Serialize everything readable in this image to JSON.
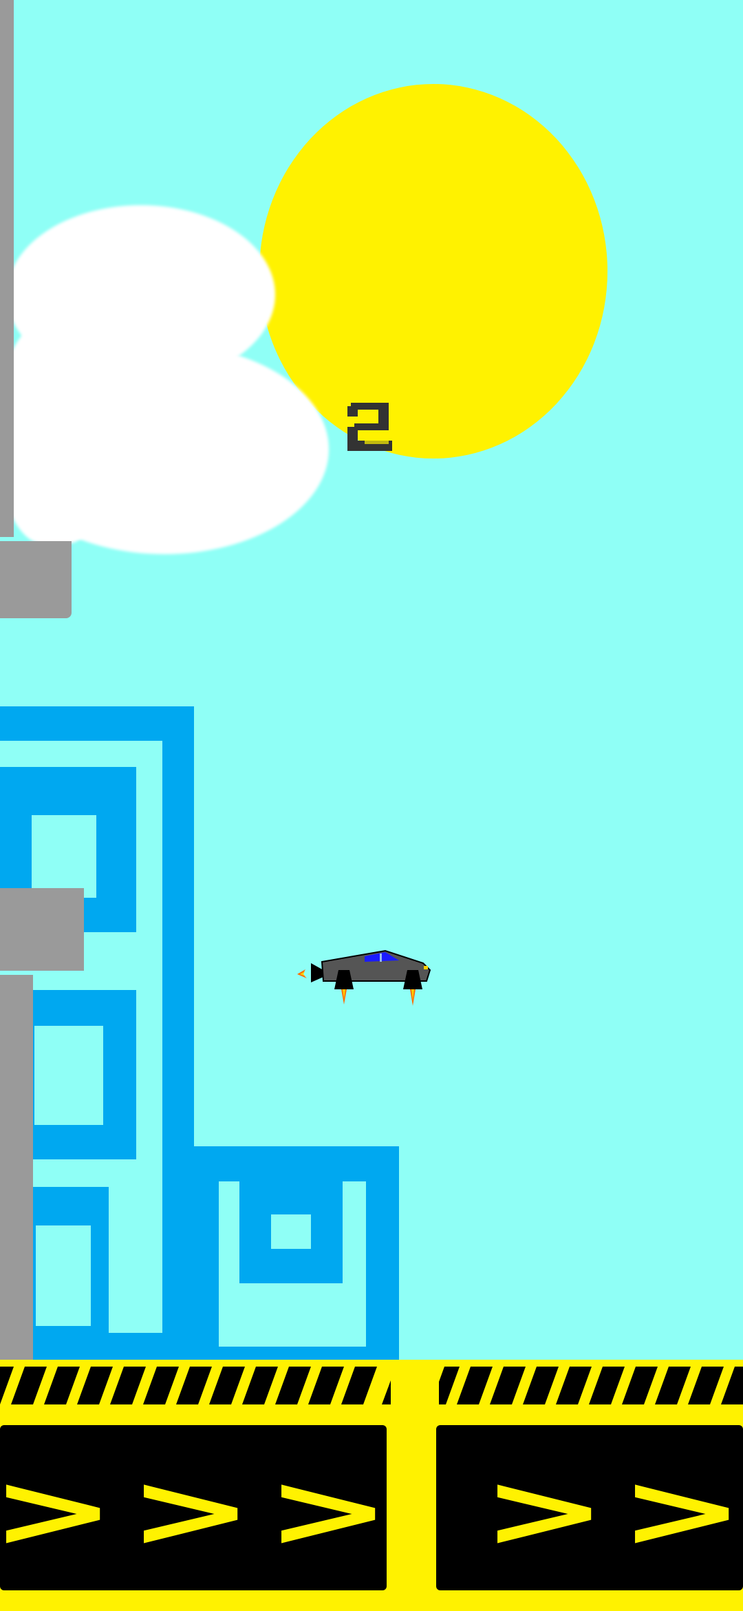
{
  "game": {
    "score": "2",
    "ground_chevron": ">"
  },
  "colors": {
    "sky": "#8ffff6",
    "sun": "#fff200",
    "cloud": "#ffffff",
    "building": "#00a8f0",
    "pipe": "#9a9a9a",
    "ground_yellow": "#fff200",
    "ground_black": "#000000",
    "score": "#333333"
  },
  "icons": {
    "player": "flying-car-icon",
    "score": "score-digit"
  }
}
